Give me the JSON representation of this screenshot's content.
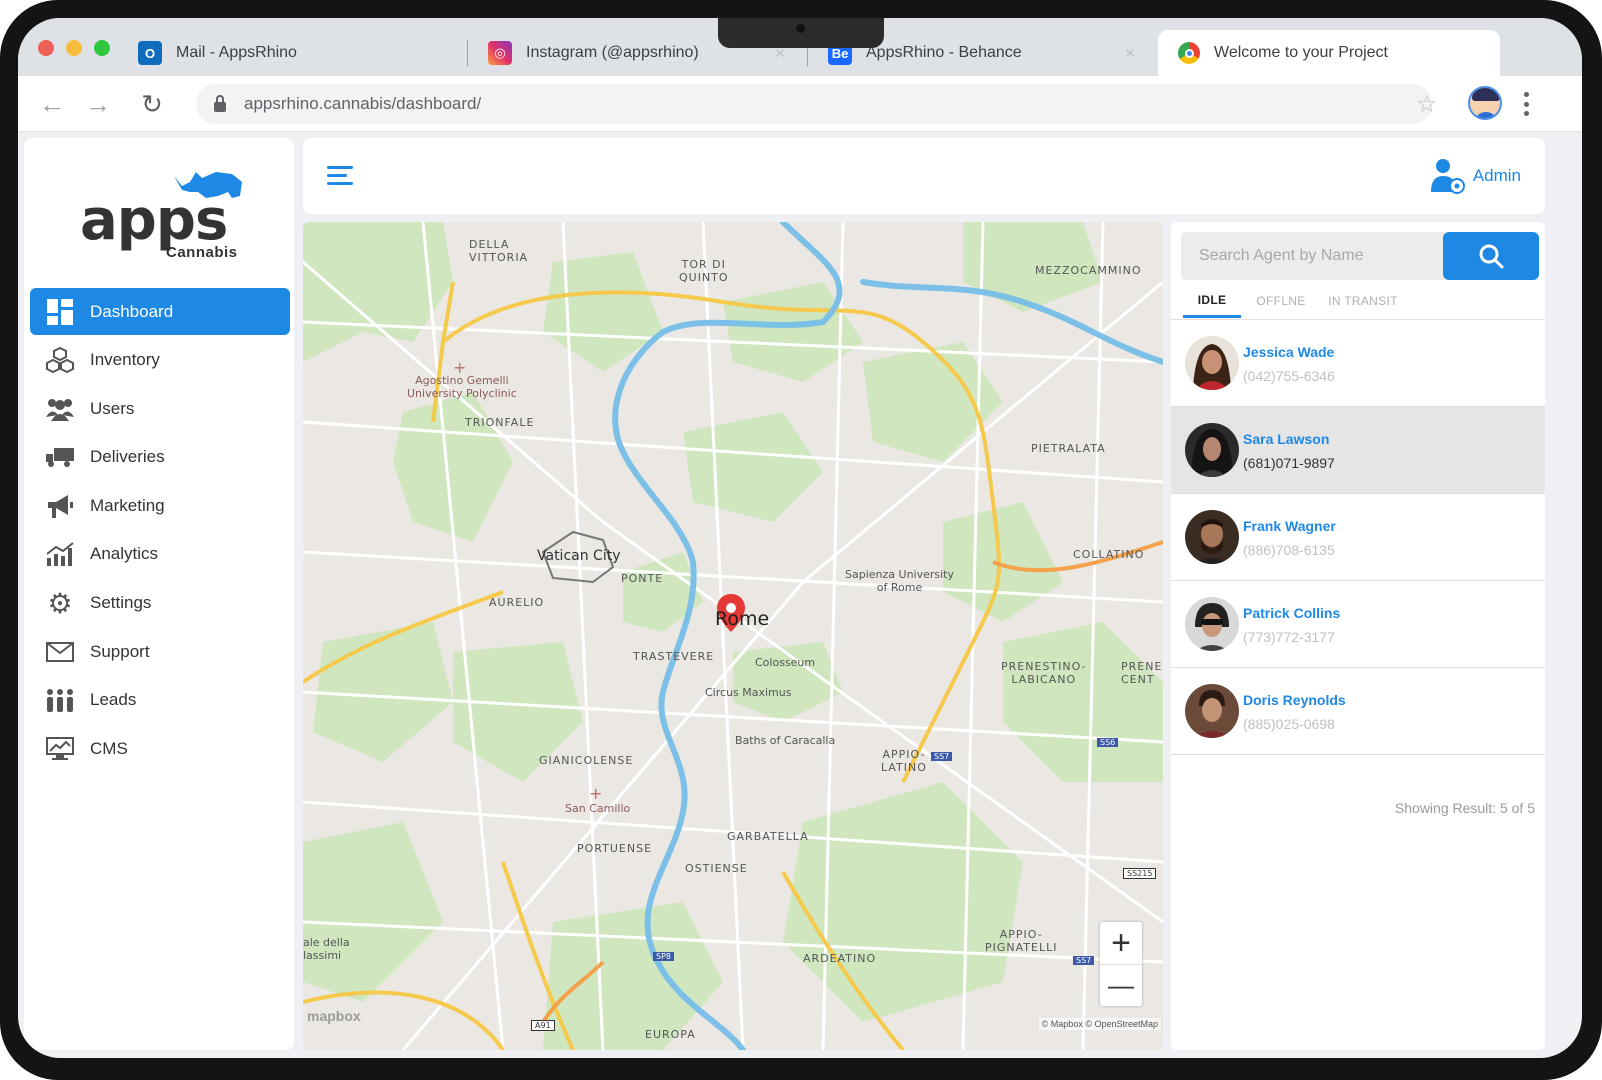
{
  "browser": {
    "tabs": [
      {
        "title": "Mail - AppsRhino",
        "icon": "outlook-icon"
      },
      {
        "title": "Instagram (@appsrhino)",
        "icon": "instagram-icon"
      },
      {
        "title": "AppsRhino - Behance",
        "icon": "behance-icon"
      },
      {
        "title": "Welcome to your Project",
        "icon": "chrome-icon"
      }
    ],
    "url": "appsrhino.cannabis/dashboard/"
  },
  "brand": {
    "name": "apps",
    "subtitle": "Cannabis",
    "accent": "#1e88e5"
  },
  "sidebar": {
    "items": [
      {
        "label": "Dashboard",
        "icon": "dashboard-icon",
        "active": true
      },
      {
        "label": "Inventory",
        "icon": "inventory-icon"
      },
      {
        "label": "Users",
        "icon": "users-icon"
      },
      {
        "label": "Deliveries",
        "icon": "truck-icon"
      },
      {
        "label": "Marketing",
        "icon": "megaphone-icon"
      },
      {
        "label": "Analytics",
        "icon": "chart-icon"
      },
      {
        "label": "Settings",
        "icon": "gear-icon"
      },
      {
        "label": "Support",
        "icon": "envelope-icon"
      },
      {
        "label": "Leads",
        "icon": "people-icon"
      },
      {
        "label": "CMS",
        "icon": "monitor-icon"
      }
    ]
  },
  "header": {
    "user_label": "Admin"
  },
  "map": {
    "labels": {
      "della_vittoria": "DELLA\nVITTORIA",
      "tor_di_quinto": "TOR DI\nQUINTO",
      "mezzocammino": "MEZZOCAMMINO",
      "gemelli": "Agostino Gemelli\nUniversity Polyclinic",
      "trionfale": "TRIONFALE",
      "pietralata": "PIETRALATA",
      "vatican": "Vatican City",
      "ponte": "PONTE",
      "aurelio": "AURELIO",
      "rome": "Rome",
      "sapienza": "Sapienza University\nof Rome",
      "collatino": "COLLATINO",
      "trastevere": "TRASTEVERE",
      "colosseum": "Colosseum",
      "circus": "Circus Maximus",
      "prenestino": "PRENESTINO-\nLABICANO",
      "prene": "PRENE\nCENT",
      "caracalla": "Baths of Caracalla",
      "appio_latino": "APPIO-\nLATINO",
      "gianicolense": "GIANICOLENSE",
      "san_camillo": "San Camillo",
      "garbatella": "GARBATELLA",
      "portuense": "PORTUENSE",
      "ostiense": "OSTIENSE",
      "appio_pignatelli": "APPIO-\nPIGNATELLI",
      "ardeatino": "ARDEATINO",
      "valle": "ale della\nlassimi",
      "ss7a": "SS7",
      "ss6": "SS6",
      "ss215": "SS215",
      "sp8": "SP8",
      "ss7b": "SS7",
      "a91": "A91",
      "europa": "EUROPA"
    },
    "zoom_in": "+",
    "zoom_out": "—",
    "logo": "mapbox",
    "attribution": "© Mapbox © OpenStreetMap"
  },
  "agents_panel": {
    "search_placeholder": "Search Agent by Name",
    "tabs": [
      "IDLE",
      "OFFLNE",
      "IN TRANSIT"
    ],
    "active_tab": "IDLE",
    "agents": [
      {
        "name": "Jessica Wade",
        "phone": "(042)755-6346"
      },
      {
        "name": "Sara Lawson",
        "phone": "(681)071-9897"
      },
      {
        "name": "Frank Wagner",
        "phone": "(886)708-6135"
      },
      {
        "name": "Patrick Collins",
        "phone": "(773)772-3177"
      },
      {
        "name": "Doris Reynolds",
        "phone": "(885)025-0698"
      }
    ],
    "result_text": "Showing Result: 5 of 5"
  }
}
